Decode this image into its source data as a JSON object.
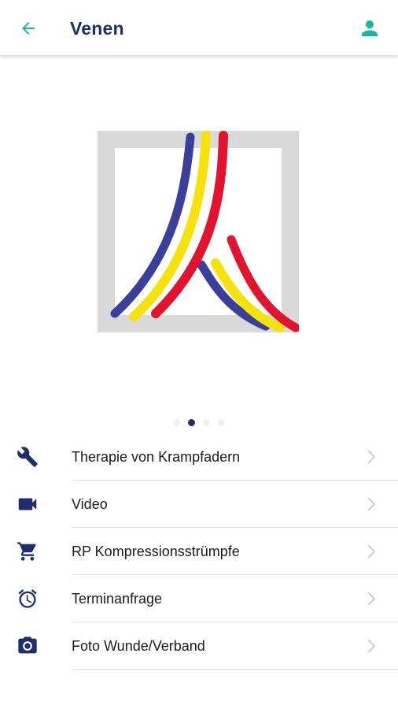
{
  "colors": {
    "accent": "#1bb59a",
    "brand": "#1e2f6b",
    "logo_blue": "#3a3f9a",
    "logo_yellow": "#f4e20a",
    "logo_red": "#e0142e",
    "logo_frame": "#d9d9d9"
  },
  "header": {
    "title": "Venen",
    "back_icon": "arrow-left-icon",
    "profile_icon": "person-icon"
  },
  "carousel": {
    "slide_count": 4,
    "active_index": 1
  },
  "menu": {
    "items": [
      {
        "icon": "wrench-icon",
        "label": "Therapie von Krampfadern"
      },
      {
        "icon": "video-camera-icon",
        "label": "Video"
      },
      {
        "icon": "shopping-cart-icon",
        "label": "RP Kompressionsstrümpfe"
      },
      {
        "icon": "alarm-clock-icon",
        "label": "Terminanfrage"
      },
      {
        "icon": "camera-icon",
        "label": "Foto Wunde/Verband"
      }
    ]
  }
}
